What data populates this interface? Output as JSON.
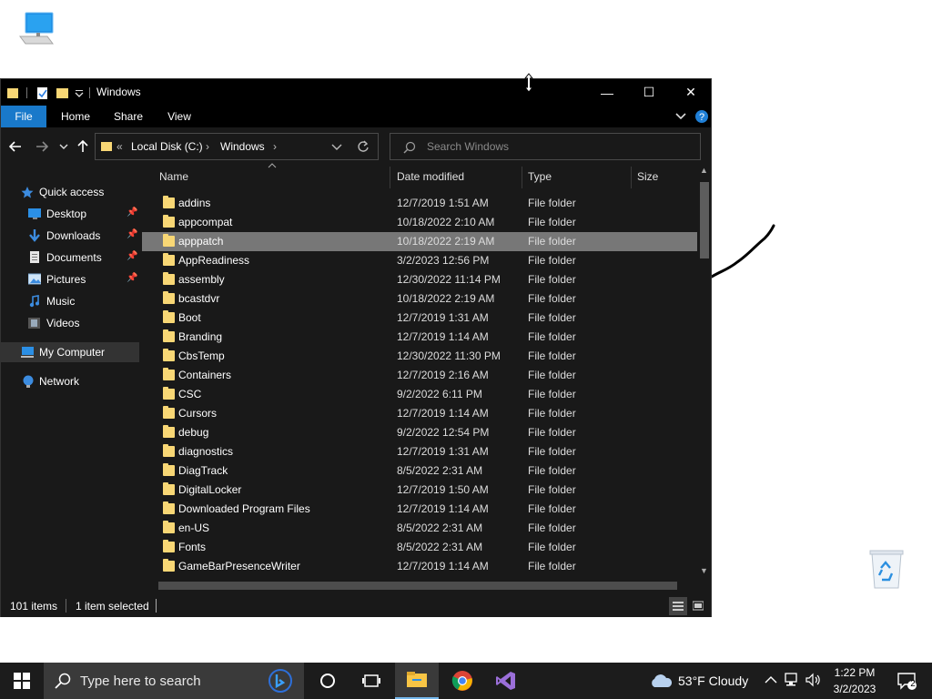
{
  "window": {
    "title": "Windows",
    "controls": {
      "minimize": "—",
      "maximize": "☐",
      "close": "✕"
    }
  },
  "ribbon": {
    "tabs": [
      "File",
      "Home",
      "Share",
      "View"
    ]
  },
  "address": {
    "overflow": "«",
    "parts": [
      "Local Disk (C:)",
      "Windows"
    ],
    "separator": "›"
  },
  "search": {
    "placeholder": "Search Windows"
  },
  "nav": {
    "quick_access": "Quick access",
    "items": [
      {
        "label": "Desktop",
        "icon": "desktop-icon",
        "pinned": true
      },
      {
        "label": "Downloads",
        "icon": "download-icon",
        "pinned": true
      },
      {
        "label": "Documents",
        "icon": "documents-icon",
        "pinned": true
      },
      {
        "label": "Pictures",
        "icon": "pictures-icon",
        "pinned": true
      },
      {
        "label": "Music",
        "icon": "music-icon",
        "pinned": false
      },
      {
        "label": "Videos",
        "icon": "videos-icon",
        "pinned": false
      }
    ],
    "my_computer": "My Computer",
    "network": "Network"
  },
  "columns": {
    "name": "Name",
    "date": "Date modified",
    "type": "Type",
    "size": "Size"
  },
  "files": [
    {
      "name": "addins",
      "date": "12/7/2019 1:51 AM",
      "type": "File folder"
    },
    {
      "name": "appcompat",
      "date": "10/18/2022 2:10 AM",
      "type": "File folder"
    },
    {
      "name": "apppatch",
      "date": "10/18/2022 2:19 AM",
      "type": "File folder",
      "selected": true
    },
    {
      "name": "AppReadiness",
      "date": "3/2/2023 12:56 PM",
      "type": "File folder"
    },
    {
      "name": "assembly",
      "date": "12/30/2022 11:14 PM",
      "type": "File folder"
    },
    {
      "name": "bcastdvr",
      "date": "10/18/2022 2:19 AM",
      "type": "File folder"
    },
    {
      "name": "Boot",
      "date": "12/7/2019 1:31 AM",
      "type": "File folder"
    },
    {
      "name": "Branding",
      "date": "12/7/2019 1:14 AM",
      "type": "File folder"
    },
    {
      "name": "CbsTemp",
      "date": "12/30/2022 11:30 PM",
      "type": "File folder"
    },
    {
      "name": "Containers",
      "date": "12/7/2019 2:16 AM",
      "type": "File folder"
    },
    {
      "name": "CSC",
      "date": "9/2/2022 6:11 PM",
      "type": "File folder"
    },
    {
      "name": "Cursors",
      "date": "12/7/2019 1:14 AM",
      "type": "File folder"
    },
    {
      "name": "debug",
      "date": "9/2/2022 12:54 PM",
      "type": "File folder"
    },
    {
      "name": "diagnostics",
      "date": "12/7/2019 1:31 AM",
      "type": "File folder"
    },
    {
      "name": "DiagTrack",
      "date": "8/5/2022 2:31 AM",
      "type": "File folder"
    },
    {
      "name": "DigitalLocker",
      "date": "12/7/2019 1:50 AM",
      "type": "File folder"
    },
    {
      "name": "Downloaded Program Files",
      "date": "12/7/2019 1:14 AM",
      "type": "File folder"
    },
    {
      "name": "en-US",
      "date": "8/5/2022 2:31 AM",
      "type": "File folder"
    },
    {
      "name": "Fonts",
      "date": "8/5/2022 2:31 AM",
      "type": "File folder"
    },
    {
      "name": "GameBarPresenceWriter",
      "date": "12/7/2019 1:14 AM",
      "type": "File folder"
    }
  ],
  "status": {
    "count": "101 items",
    "selected": "1 item selected"
  },
  "taskbar": {
    "search_placeholder": "Type here to search",
    "weather": "53°F  Cloudy",
    "time": "1:22 PM",
    "date": "3/2/2023",
    "notifications": "2"
  },
  "colors": {
    "file_tab": "#1979ca",
    "folder": "#f8d775",
    "selected_row": "#777777",
    "window_bg": "#191919"
  }
}
